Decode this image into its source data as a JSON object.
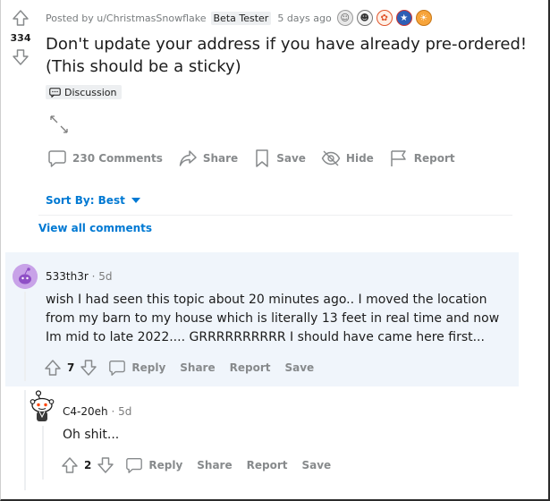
{
  "post": {
    "score": "334",
    "posted_by": "Posted by u/ChristmasSnowflake",
    "user_flair": "Beta Tester",
    "time": "5 days ago",
    "title": "Don't update your address if you have already pre-ordered! (This should be a sticky)",
    "flair": "Discussion",
    "actions": {
      "comments": "230 Comments",
      "share": "Share",
      "save": "Save",
      "hide": "Hide",
      "report": "Report"
    }
  },
  "sort": {
    "label": "Sort By: Best"
  },
  "view_all": "View all comments",
  "comments": [
    {
      "author": "533th3r",
      "time": "5d",
      "body": "wish I had seen this topic about 20 minutes ago.. I moved the location from my barn to my house which is literally 13 feet in real time and now Im mid to late 2022.... GRRRRRRRRRR I should have came here first...",
      "score": "7",
      "actions": {
        "reply": "Reply",
        "share": "Share",
        "report": "Report",
        "save": "Save"
      }
    },
    {
      "author": "C4-20eh",
      "time": "5d",
      "body": "Oh shit...",
      "score": "2",
      "actions": {
        "reply": "Reply",
        "share": "Share",
        "report": "Report",
        "save": "Save"
      }
    }
  ],
  "colors": {
    "link_blue": "#0079d3",
    "meta_gray": "#787c7e",
    "action_gray": "#878a8c",
    "highlight_bg": "#f0f5fb"
  },
  "icons": [
    "upvote-icon",
    "downvote-icon",
    "chat-bubble-icon",
    "share-arrow-icon",
    "bookmark-icon",
    "eye-slash-icon",
    "flag-icon",
    "expand-icon",
    "caret-down-icon"
  ]
}
